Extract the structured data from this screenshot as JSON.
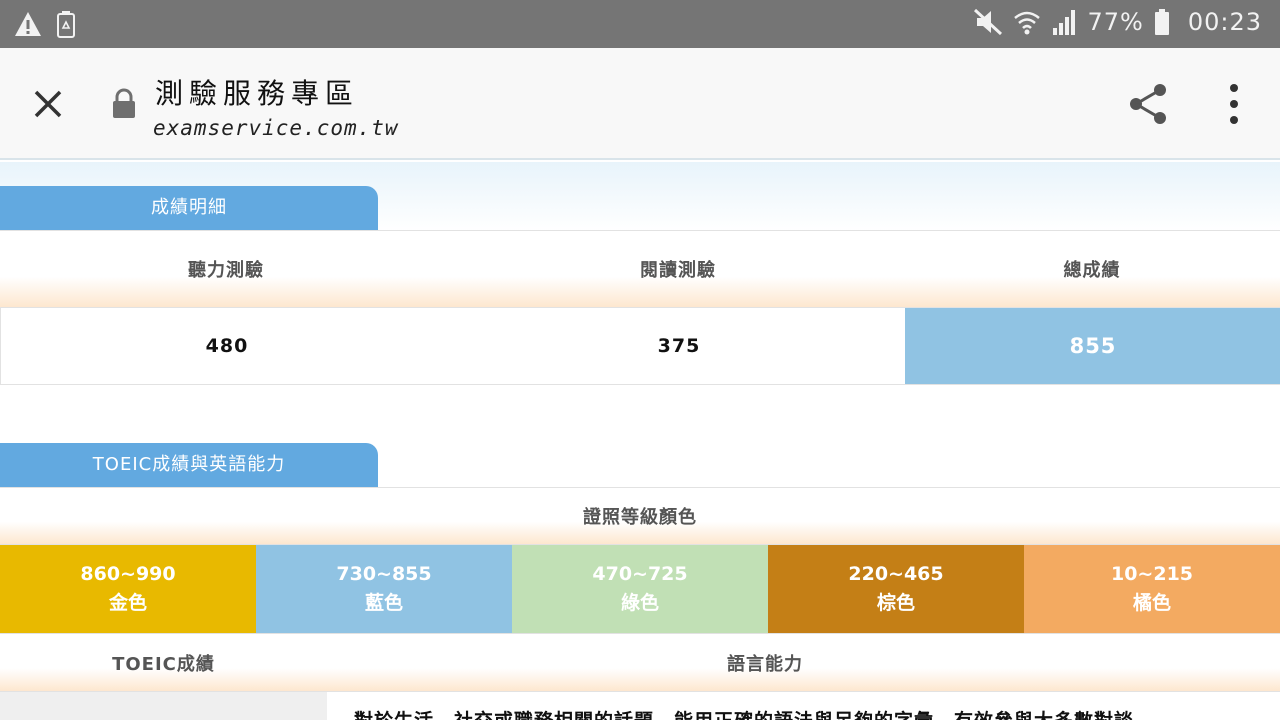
{
  "status_bar": {
    "battery": "77%",
    "time": "00:23",
    "left_icons": [
      "warning-icon",
      "recycle-battery-icon"
    ],
    "right_icons": [
      "mute-icon",
      "wifi-icon",
      "signal-icon",
      "battery-icon"
    ]
  },
  "toolbar": {
    "title": "測驗服務專區",
    "url": "examservice.com.tw",
    "close_icon": "close-icon",
    "lock_icon": "lock-icon",
    "share_icon": "share-icon",
    "more_icon": "more-vertical-icon"
  },
  "score_section": {
    "tab_label": "成績明細",
    "headers": [
      "聽力測驗",
      "閱讀測驗",
      "總成績"
    ],
    "values": [
      "480",
      "375",
      "855"
    ],
    "highlight_color": "#90c3e3"
  },
  "toeic_section": {
    "tab_label": "TOEIC成績與英語能力",
    "header": "證照等級顏色",
    "levels": [
      {
        "range": "860~990",
        "color_name": "金色",
        "color": "#e8b900"
      },
      {
        "range": "730~855",
        "color_name": "藍色",
        "color": "#90c3e3"
      },
      {
        "range": "470~725",
        "color_name": "綠色",
        "color": "#c1e0b5"
      },
      {
        "range": "220~465",
        "color_name": "棕色",
        "color": "#c47f16"
      },
      {
        "range": "10~215",
        "color_name": "橘色",
        "color": "#f3aa61"
      }
    ],
    "col_score_header": "TOEIC成績",
    "col_ability_header": "語言能力",
    "ability_text_partial": "對於生活、社交或職務相關的話題，能用正確的語法與足夠的字彙，有效參與大多數對談"
  },
  "accent_color": "#62a9e0"
}
